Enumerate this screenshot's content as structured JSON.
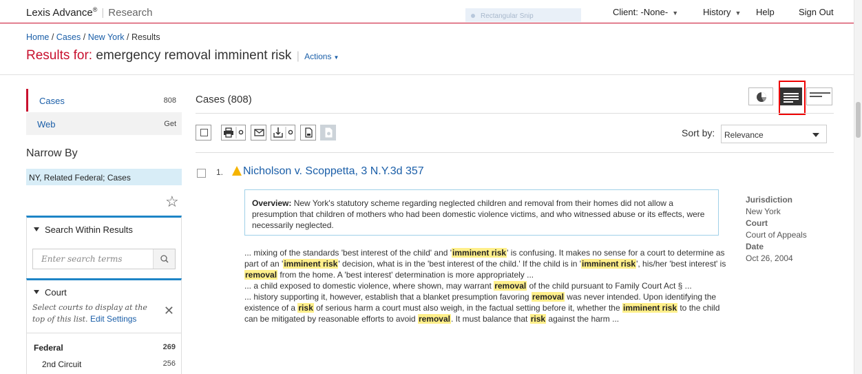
{
  "topbar": {
    "brand": "Lexis Advance",
    "brand_mark": "®",
    "brand_sub": "Research",
    "snip_label": "Rectangular Snip",
    "client": "Client: -None-",
    "history": "History",
    "help": "Help",
    "sign_out": "Sign Out"
  },
  "breadcrumb": {
    "items": [
      "Home",
      "Cases",
      "New York"
    ],
    "sep": "/",
    "current": "Results"
  },
  "title": {
    "lead": "Results for:",
    "query": "emergency removal imminent risk",
    "actions": "Actions"
  },
  "sidebar": {
    "tabs": [
      {
        "label": "Cases",
        "count": "808"
      },
      {
        "label": "Web",
        "count": "Get"
      }
    ],
    "narrow_by": "Narrow By",
    "narrow_chip": "NY, Related Federal; Cases",
    "search_within": {
      "heading": "Search Within Results",
      "placeholder": "Enter search terms"
    },
    "court": {
      "heading": "Court",
      "note": "Select courts to display at the top of this list.",
      "edit_settings": "Edit Settings",
      "rows": [
        {
          "label": "Federal",
          "count": "269"
        },
        {
          "label": "2nd Circuit",
          "count": "256"
        }
      ]
    }
  },
  "main": {
    "heading": "Cases (808)",
    "sort_label": "Sort by:",
    "sort_value": "Relevance",
    "result": {
      "number": "1.",
      "title": "Nicholson v. Scoppetta, 3 N.Y.3d 357",
      "overview_label": "Overview:",
      "overview_text": "New York's statutory scheme regarding neglected children and removal from their homes did not allow a presumption that children of mothers who had been domestic violence victims, and who witnessed abuse or its effects, were necessarily neglected.",
      "snip1": {
        "a": "... mixing of the standards 'best interest of the child' and '",
        "h1": "imminent risk",
        "b": "' is confusing. It makes no sense for a court to determine as part of an '",
        "h2": "imminent risk",
        "c": "' decision, what is in the 'best interest of the child.' If the child is in '",
        "h3": "imminent risk",
        "d": "', his/her 'best interest' is ",
        "h4": "removal",
        "e": " from the home. A 'best interest' determination is more appropriately ..."
      },
      "snip2": {
        "a": "... a child exposed to domestic violence, where shown, may warrant ",
        "h1": "removal",
        "b": " of the child pursuant to Family Court Act § ..."
      },
      "snip3": {
        "a": "... history supporting it, however, establish that a blanket presumption favoring ",
        "h1": "removal",
        "b": " was never intended. Upon identifying the existence of a ",
        "h2": "risk",
        "c": " of serious harm a court must also weigh, in the factual setting before it, whether the ",
        "h3": "imminent risk",
        "d": " to the child can be mitigated by reasonable efforts to avoid ",
        "h4": "removal",
        "e": ". It must balance that ",
        "h5": "risk",
        "f": " against the harm ..."
      },
      "meta": {
        "jurisdiction_label": "Jurisdiction",
        "jurisdiction": "New York",
        "court_label": "Court",
        "court": "Court of Appeals",
        "date_label": "Date",
        "date": "Oct 26, 2004"
      }
    }
  },
  "colors": {
    "brand_red": "#c8102e",
    "link_blue": "#1a5ea8",
    "highlight": "#ffef8a",
    "panel_accent": "#1d84c6"
  }
}
